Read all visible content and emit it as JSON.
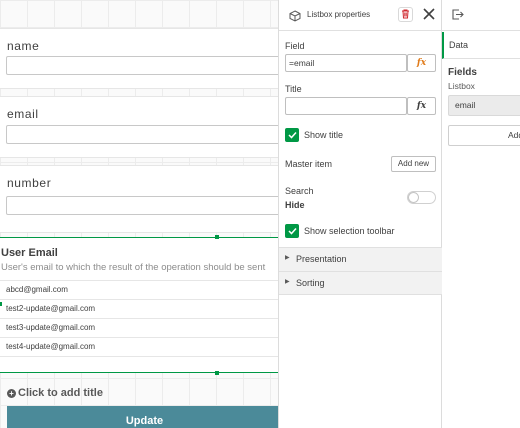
{
  "canvas": {
    "fields": [
      {
        "label": "name"
      },
      {
        "label": "email"
      },
      {
        "label": "number"
      }
    ],
    "listbox": {
      "title": "User Email",
      "subtitle": "User's email to which the result of the operation should be sent",
      "items": [
        "abcd@gmail.com",
        "test2-update@gmail.com",
        "test3-update@gmail.com",
        "test4-update@gmail.com"
      ]
    },
    "add_title_label": "Click to add title",
    "update_label": "Update"
  },
  "properties": {
    "title": "Listbox properties",
    "field_label": "Field",
    "field_value": "=email",
    "fx_symbol": "fx",
    "title_label": "Title",
    "title_value": "",
    "show_title_label": "Show title",
    "show_title_checked": true,
    "master_item_label": "Master item",
    "add_new_label": "Add new",
    "search_label": "Search",
    "search_state": "Hide",
    "search_enabled": false,
    "show_toolbar_label": "Show selection toolbar",
    "show_toolbar_checked": true,
    "sections": [
      "Presentation",
      "Sorting"
    ]
  },
  "assets": {
    "tab_data": "Data",
    "fields_title": "Fields",
    "listbox_label": "Listbox",
    "field_item": "email",
    "add_label": "Add"
  },
  "colors": {
    "accent_green": "#009845",
    "update_button": "#4b8a99",
    "delete_red": "#d0282e",
    "fx_orange": "#e07b1a"
  },
  "icons": {
    "props_header": "cube-icon",
    "delete": "trash-icon",
    "close": "close-icon",
    "assets_header": "export-icon",
    "checkbox": "check-icon",
    "section": "caret-right-icon",
    "add_title": "plus-circle-icon"
  }
}
